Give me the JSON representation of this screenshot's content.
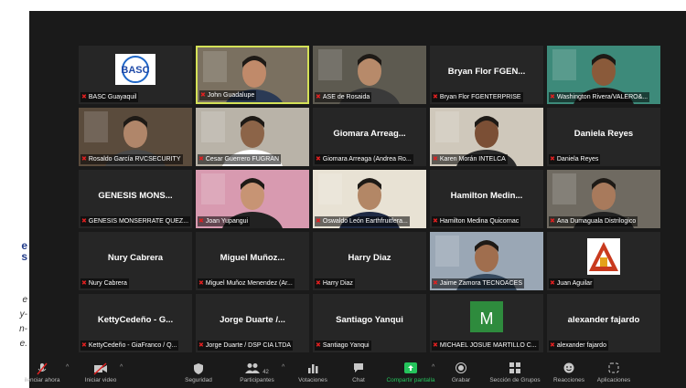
{
  "slide_fragment": {
    "line1": "e",
    "line2": "s",
    "line3": "e",
    "line4": "y-",
    "line5": "n-",
    "line6": "e."
  },
  "participants": [
    {
      "name": "BASC Guayaquil",
      "display": "",
      "type": "logo-basc",
      "logo_text": "BASC"
    },
    {
      "name": "John Guadalupe",
      "display": "",
      "type": "video",
      "speaking": true
    },
    {
      "name": "ASE de Rosaida",
      "display": "",
      "type": "video"
    },
    {
      "name": "Bryan Flor FGENTERPRISE",
      "display": "Bryan Flor FGEN...",
      "type": "name"
    },
    {
      "name": "Washington Rivera/VALERO&...",
      "display": "",
      "type": "video"
    },
    {
      "name": "Rosaldo García RVCSECURITY",
      "display": "",
      "type": "video"
    },
    {
      "name": "Cesar Guerrero FUGRAN",
      "display": "",
      "type": "video"
    },
    {
      "name": "Giomara Arreaga (Andrea Ro...",
      "display": "Giomara Arreag...",
      "type": "name"
    },
    {
      "name": "Karen Morán INTELCA",
      "display": "",
      "type": "video"
    },
    {
      "name": "Daniela Reyes",
      "display": "Daniela Reyes",
      "type": "name"
    },
    {
      "name": "GENESIS MONSERRATE QUEZ...",
      "display": "GENESIS MONS...",
      "type": "name"
    },
    {
      "name": "Joan Yupangui",
      "display": "",
      "type": "video"
    },
    {
      "name": "Oswaldo León Earthfruitfera...",
      "display": "",
      "type": "video"
    },
    {
      "name": "Hamilton Medina Quicornac",
      "display": "Hamilton Medin...",
      "type": "name"
    },
    {
      "name": "Ana Dumaguala Distrilogico",
      "display": "",
      "type": "video"
    },
    {
      "name": "Nury Cabrera",
      "display": "Nury Cabrera",
      "type": "name"
    },
    {
      "name": "Miguel Muñoz Menendez (Ar...",
      "display": "Miguel Muñoz...",
      "type": "name"
    },
    {
      "name": "Harry Diaz",
      "display": "Harry Diaz",
      "type": "name"
    },
    {
      "name": "Jaime Zamora TECNOACES",
      "display": "",
      "type": "video"
    },
    {
      "name": "Juan Aguilar",
      "display": "",
      "type": "logo-tri"
    },
    {
      "name": "KettyCedeño - GiaFranco / Q...",
      "display": "KettyCedeño - G...",
      "type": "name"
    },
    {
      "name": "Jorge Duarte / DSP CIA LTDA",
      "display": "Jorge Duarte /...",
      "type": "name"
    },
    {
      "name": "Santiago Yanqui",
      "display": "Santiago Yanqui",
      "type": "name"
    },
    {
      "name": "MICHAEL JOSUE MARTILLO C...",
      "display": "",
      "type": "avatar-m",
      "avatar_letter": "M"
    },
    {
      "name": "alexander fajardo",
      "display": "alexander fajardo",
      "type": "name"
    }
  ],
  "toolbar": {
    "unmute": "ilenciar ahora",
    "start_video": "Iniciar video",
    "security": "Seguridad",
    "participants": "Participantes",
    "participants_count": "42",
    "polls": "Votaciones",
    "chat": "Chat",
    "share": "Compartir pantalla",
    "record": "Grabar",
    "breakout": "Sección de Grupos",
    "reactions": "Reacciones",
    "apps": "Aplicaciones"
  },
  "colors": {
    "window_bg": "#1a1a1a",
    "tile_bg": "#262626",
    "speaker_border": "#d4e157",
    "share_green": "#25c45c",
    "muted_red": "#e02020"
  }
}
